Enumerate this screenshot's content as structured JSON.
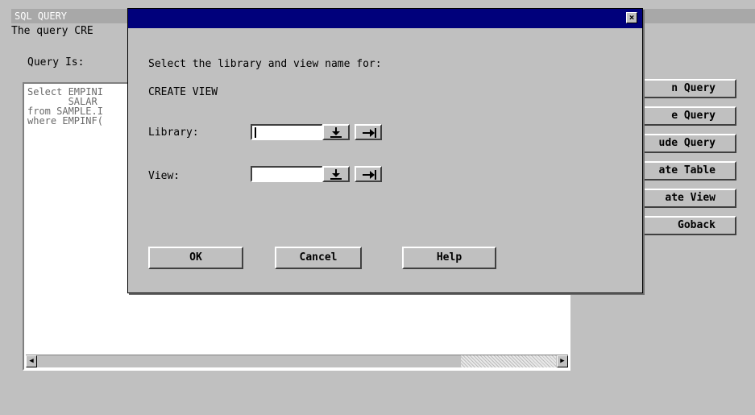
{
  "window": {
    "title": "SQL QUERY"
  },
  "background": {
    "status_text": "The query CRE",
    "query_label": "Query Is:",
    "query_lines": [
      "Select EMPINI",
      "       SALAR",
      "from SAMPLE.I",
      "where EMPINF("
    ],
    "side_buttons": [
      "n Query",
      "e Query",
      "ude Query",
      "ate Table",
      "ate View",
      "Goback"
    ]
  },
  "dialog": {
    "prompt": "Select the library and view name for:",
    "action": "CREATE VIEW",
    "library_label": "Library:",
    "library_value": "",
    "view_label": "View:",
    "view_value": "",
    "close_glyph": "×",
    "buttons": {
      "ok": "OK",
      "cancel": "Cancel",
      "help": "Help"
    }
  },
  "icons": {
    "dropdown": "download-arrow-icon",
    "advance": "right-arrow-bar-icon",
    "scroll_left": "triangle-left-icon",
    "scroll_right": "triangle-right-icon"
  },
  "colors": {
    "title_bar": "#00007b",
    "background": "#c0c0c0",
    "inactive_title": "#a8a8a8"
  }
}
